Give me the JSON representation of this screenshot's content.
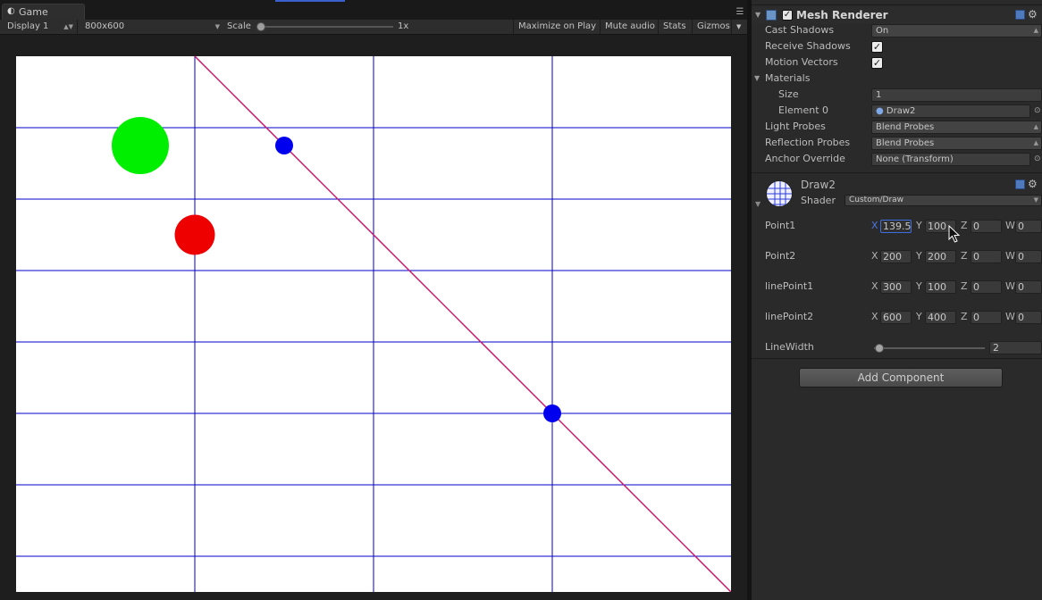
{
  "game": {
    "tab_label": "Game",
    "display": "Display 1",
    "resolution": "800x600",
    "scale_label": "Scale",
    "scale_value": "1x",
    "maximize_on_play": "Maximize on Play",
    "mute_audio": "Mute audio",
    "stats": "Stats",
    "gizmos": "Gizmos"
  },
  "scene": {
    "background": "#ffffff",
    "grid_color": "#0000c8",
    "line_color": "#c8186f",
    "grid_cols": 4,
    "grid_rows": 7.5,
    "points": {
      "green_circle": "#00ee00",
      "red_circle": "#ee0000",
      "line_endpoint": "#0000ee"
    }
  },
  "mesh_renderer": {
    "title": "Mesh Renderer",
    "enabled": true,
    "cast_shadows_label": "Cast Shadows",
    "cast_shadows_value": "On",
    "receive_shadows_label": "Receive Shadows",
    "receive_shadows": true,
    "motion_vectors_label": "Motion Vectors",
    "motion_vectors": true,
    "materials_label": "Materials",
    "size_label": "Size",
    "size_value": "1",
    "element0_label": "Element 0",
    "element0_value": "Draw2",
    "light_probes_label": "Light Probes",
    "light_probes_value": "Blend Probes",
    "reflection_probes_label": "Reflection Probes",
    "reflection_probes_value": "Blend Probes",
    "anchor_override_label": "Anchor Override",
    "anchor_override_value": "None (Transform)"
  },
  "material": {
    "name": "Draw2",
    "shader_label": "Shader",
    "shader_value": "Custom/Draw",
    "props": [
      {
        "label": "Point1",
        "x": "139.5",
        "y": "100",
        "z": "0",
        "w": "0"
      },
      {
        "label": "Point2",
        "x": "200",
        "y": "200",
        "z": "0",
        "w": "0"
      },
      {
        "label": "linePoint1",
        "x": "300",
        "y": "100",
        "z": "0",
        "w": "0"
      },
      {
        "label": "linePoint2",
        "x": "600",
        "y": "400",
        "z": "0",
        "w": "0"
      }
    ],
    "line_width_label": "LineWidth",
    "line_width_value": "2",
    "axis": {
      "x": "X",
      "y": "Y",
      "z": "Z",
      "w": "W"
    }
  },
  "add_component": "Add Component"
}
